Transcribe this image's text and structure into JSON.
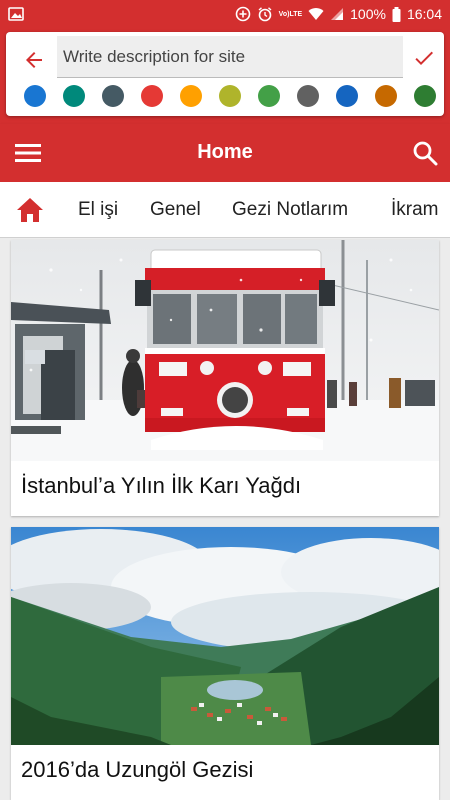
{
  "status_bar": {
    "volte_top": "Vo)",
    "volte_bottom": "LTE",
    "battery": "100%",
    "time": "16:04"
  },
  "description": {
    "placeholder": "Write description for site",
    "colors": [
      "#1976d2",
      "#00897b",
      "#455a64",
      "#e53935",
      "#ffa000",
      "#afb42b",
      "#43a047",
      "#616161",
      "#1565c0",
      "#c66900",
      "#2e7d32"
    ]
  },
  "toolbar": {
    "title": "Home"
  },
  "tabs": [
    "El işi",
    "Genel",
    "Gezi Notlarım",
    "İkram"
  ],
  "feed": [
    {
      "caption": "İstanbul’a Yılın İlk Karı Yağdı"
    },
    {
      "caption": "2016’da Uzungöl Gezisi"
    }
  ],
  "accent_color": "#d32f2f"
}
